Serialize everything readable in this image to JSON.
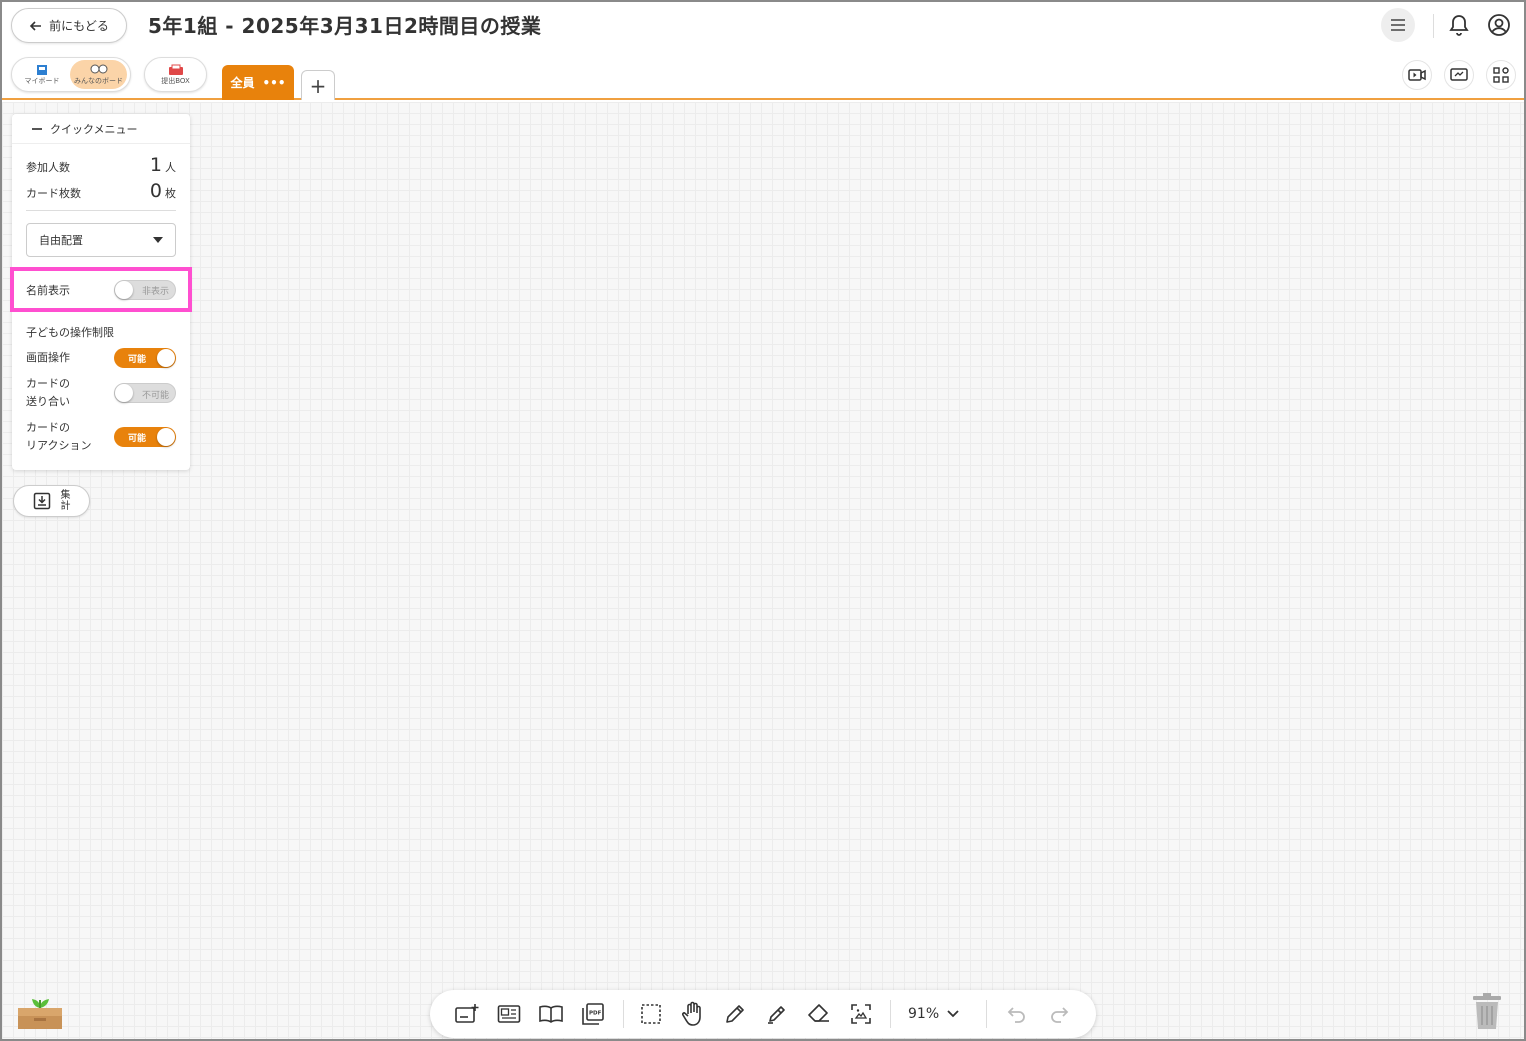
{
  "header": {
    "back_label": "前にもどる",
    "title": "5年1組 - 2025年3月31日2時間目の授業"
  },
  "board_switch": {
    "my_board": "マイボード",
    "all_board": "みんなのボード"
  },
  "submit_box": "提出BOX",
  "tabs": {
    "all_label": "全員",
    "more": "•••",
    "add": "+"
  },
  "quick_menu": {
    "title": "クイックメニュー",
    "participants_label": "参加人数",
    "participants_value": "1",
    "participants_unit": "人",
    "cards_label": "カード枚数",
    "cards_value": "0",
    "cards_unit": "枚",
    "layout_value": "自由配置",
    "name_display_label": "名前表示",
    "name_display_state": "非表示",
    "child_limits_label": "子どもの操作制限",
    "screen_op_label": "画面操作",
    "screen_op_state": "可能",
    "card_send_label_1": "カードの",
    "card_send_label_2": "送り合い",
    "card_send_state": "不可能",
    "card_react_label_1": "カードの",
    "card_react_label_2": "リアクション",
    "card_react_state": "可能"
  },
  "summary": {
    "label_1": "集",
    "label_2": "計"
  },
  "toolbar": {
    "zoom": "91%"
  },
  "colors": {
    "accent": "#e8820c",
    "highlight": "#ff4fd0"
  }
}
